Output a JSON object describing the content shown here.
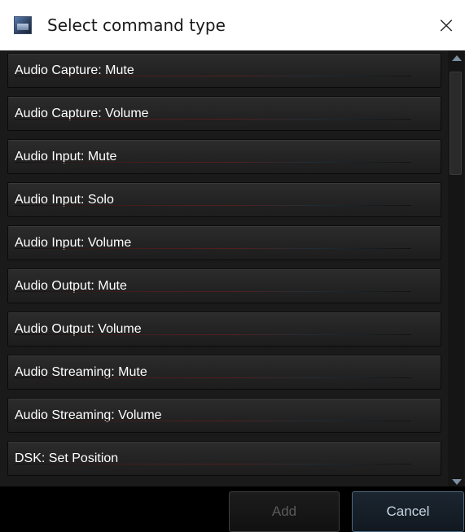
{
  "window": {
    "title": "Select command type",
    "close_glyph": "×",
    "app_icon": "app-monitor-icon"
  },
  "list": {
    "items": [
      {
        "label": "Audio Capture: Mute"
      },
      {
        "label": "Audio Capture: Volume"
      },
      {
        "label": "Audio Input: Mute"
      },
      {
        "label": "Audio Input: Solo"
      },
      {
        "label": "Audio Input: Volume"
      },
      {
        "label": "Audio Output: Mute"
      },
      {
        "label": "Audio Output: Volume"
      },
      {
        "label": "Audio Streaming: Mute"
      },
      {
        "label": "Audio Streaming: Volume"
      },
      {
        "label": "DSK: Set Position"
      }
    ]
  },
  "buttons": {
    "add_label": "Add",
    "add_enabled": false,
    "cancel_label": "Cancel"
  },
  "colors": {
    "background": "#141414",
    "item_text": "#ffffff",
    "cancel_border": "#4d6a84",
    "disabled_text": "#5a5a5a"
  }
}
